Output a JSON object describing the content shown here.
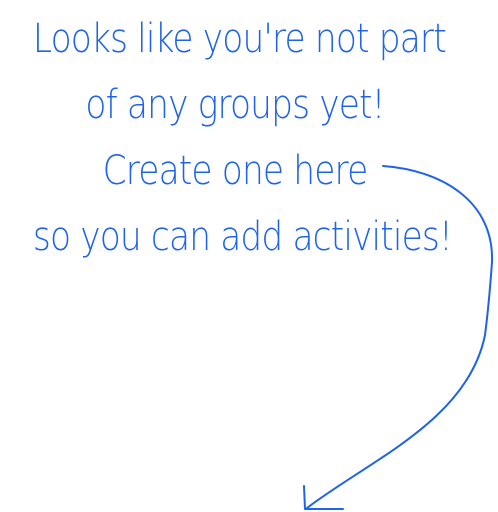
{
  "empty_state": {
    "lines": [
      "Looks like you're not part",
      "of any groups yet!",
      "Create one here",
      "so you can add activities!"
    ],
    "arrow_icon": "curved-arrow-down-left-icon"
  },
  "colors": {
    "ink": "#1f63e8",
    "background": "#ffffff"
  }
}
